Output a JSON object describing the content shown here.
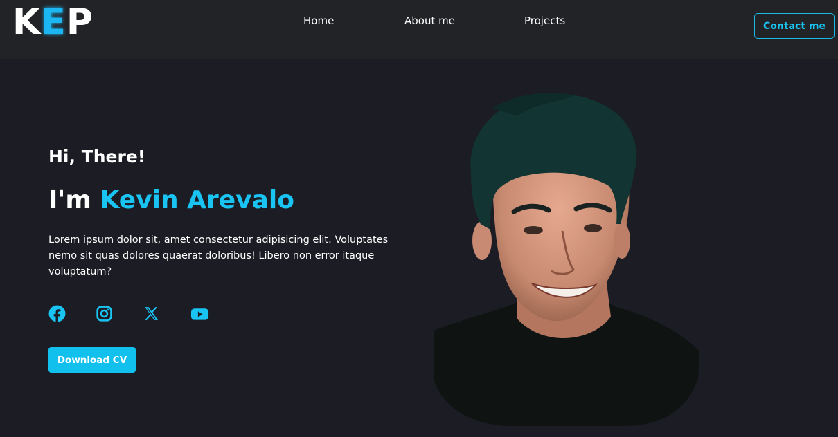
{
  "header": {
    "logo": {
      "letter1": "K",
      "letter2": "E",
      "letter3": "P"
    },
    "nav": [
      {
        "label": "Home"
      },
      {
        "label": "About me"
      },
      {
        "label": "Projects"
      }
    ],
    "contact_label": "Contact me"
  },
  "hero": {
    "greeting": "Hi, There!",
    "intro_prefix": "I'm",
    "name": "Kevin Arevalo",
    "bio": "Lorem ipsum dolor sit, amet consectetur adipisicing elit. Voluptates nemo sit quas dolores quaerat doloribus! Libero non error itaque voluptatum?",
    "socials": [
      {
        "icon": "facebook-icon"
      },
      {
        "icon": "instagram-icon"
      },
      {
        "icon": "x-twitter-icon"
      },
      {
        "icon": "youtube-icon"
      }
    ],
    "download_label": "Download CV"
  },
  "colors": {
    "accent": "#19c3f2",
    "background": "#1b1c24",
    "header_background": "#222327",
    "text": "#ffffff"
  }
}
